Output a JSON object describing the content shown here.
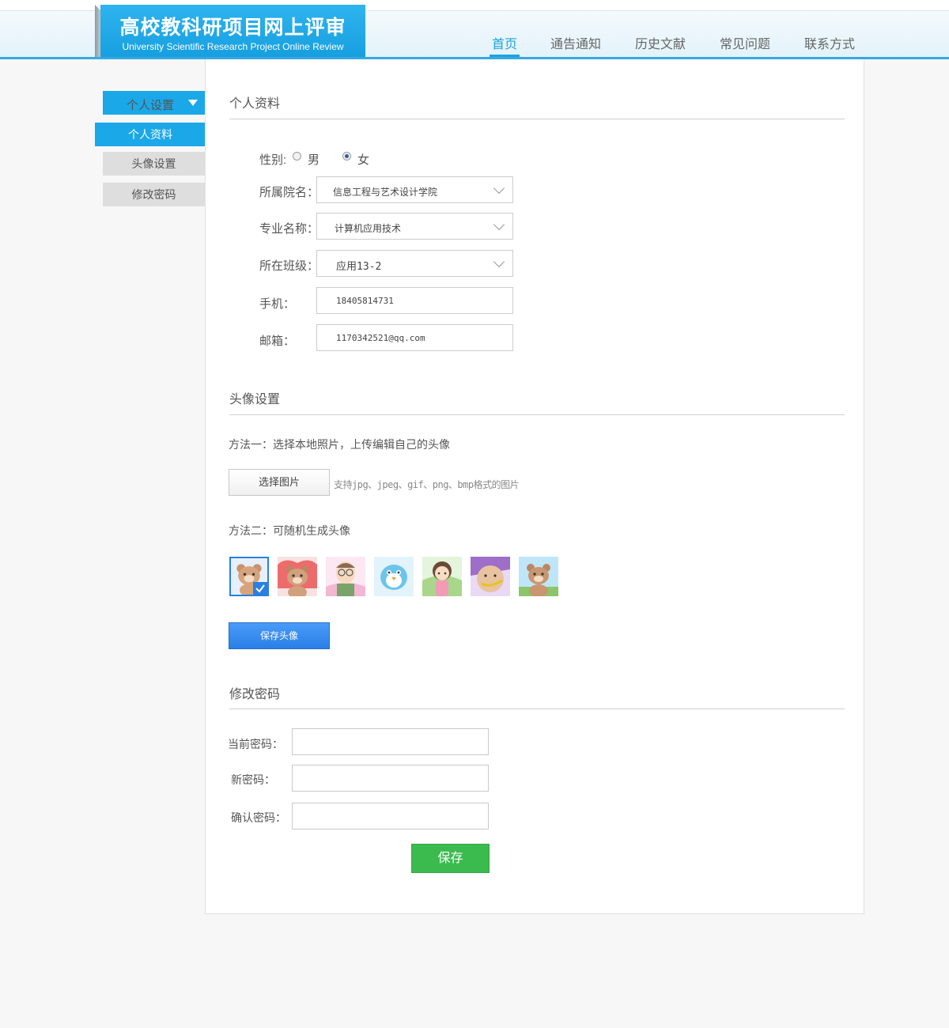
{
  "header": {
    "title": "高校教科研项目网上评审",
    "subtitle": "University Scientific Research Project Online Review",
    "nav": [
      {
        "label": "首页",
        "active": true
      },
      {
        "label": "通告通知",
        "active": false
      },
      {
        "label": "历史文献",
        "active": false
      },
      {
        "label": "常见问题",
        "active": false
      },
      {
        "label": "联系方式",
        "active": false
      }
    ]
  },
  "sidebar": {
    "head": "个人设置",
    "items": [
      {
        "label": "个人资料",
        "active": true
      },
      {
        "label": "头像设置",
        "active": false
      },
      {
        "label": "修改密码",
        "active": false
      }
    ]
  },
  "profile": {
    "title": "个人资料",
    "gender_label": "性别:",
    "gender_male": "男",
    "gender_female": "女",
    "gender_selected": "女",
    "college_label": "所属院名：",
    "college_value": "信息工程与艺术设计学院",
    "major_label": "专业名称：",
    "major_value": "计算机应用技术",
    "class_label": "所在班级：",
    "class_value": "应用13-2",
    "phone_label": "手机：",
    "phone_value": "18405814731",
    "email_label": "邮箱：",
    "email_value": "1170342521@qq.com"
  },
  "avatar": {
    "title": "头像设置",
    "method1": "方法一：选择本地照片，上传编辑自己的头像",
    "upload_button": "选择图片",
    "upload_hint": "支持jpg、jpeg、gif、png、bmp格式的图片",
    "method2": "方法二：可随机生成头像",
    "options": [
      "bear-avatar",
      "bear-heart-avatar",
      "glasses-boy-avatar",
      "blue-bird-avatar",
      "girl-avatar",
      "round-boy-avatar",
      "bear-outdoor-avatar"
    ],
    "selected_index": 0,
    "save_button": "保存头像"
  },
  "password": {
    "title": "修改密码",
    "current_label": "当前密码：",
    "new_label": "新密码：",
    "confirm_label": "确认密码：",
    "save_button": "保存"
  },
  "colors": {
    "brand": "#1aa8e8",
    "save_avatar": "#2a7fe8",
    "save": "#3bbb4e"
  }
}
